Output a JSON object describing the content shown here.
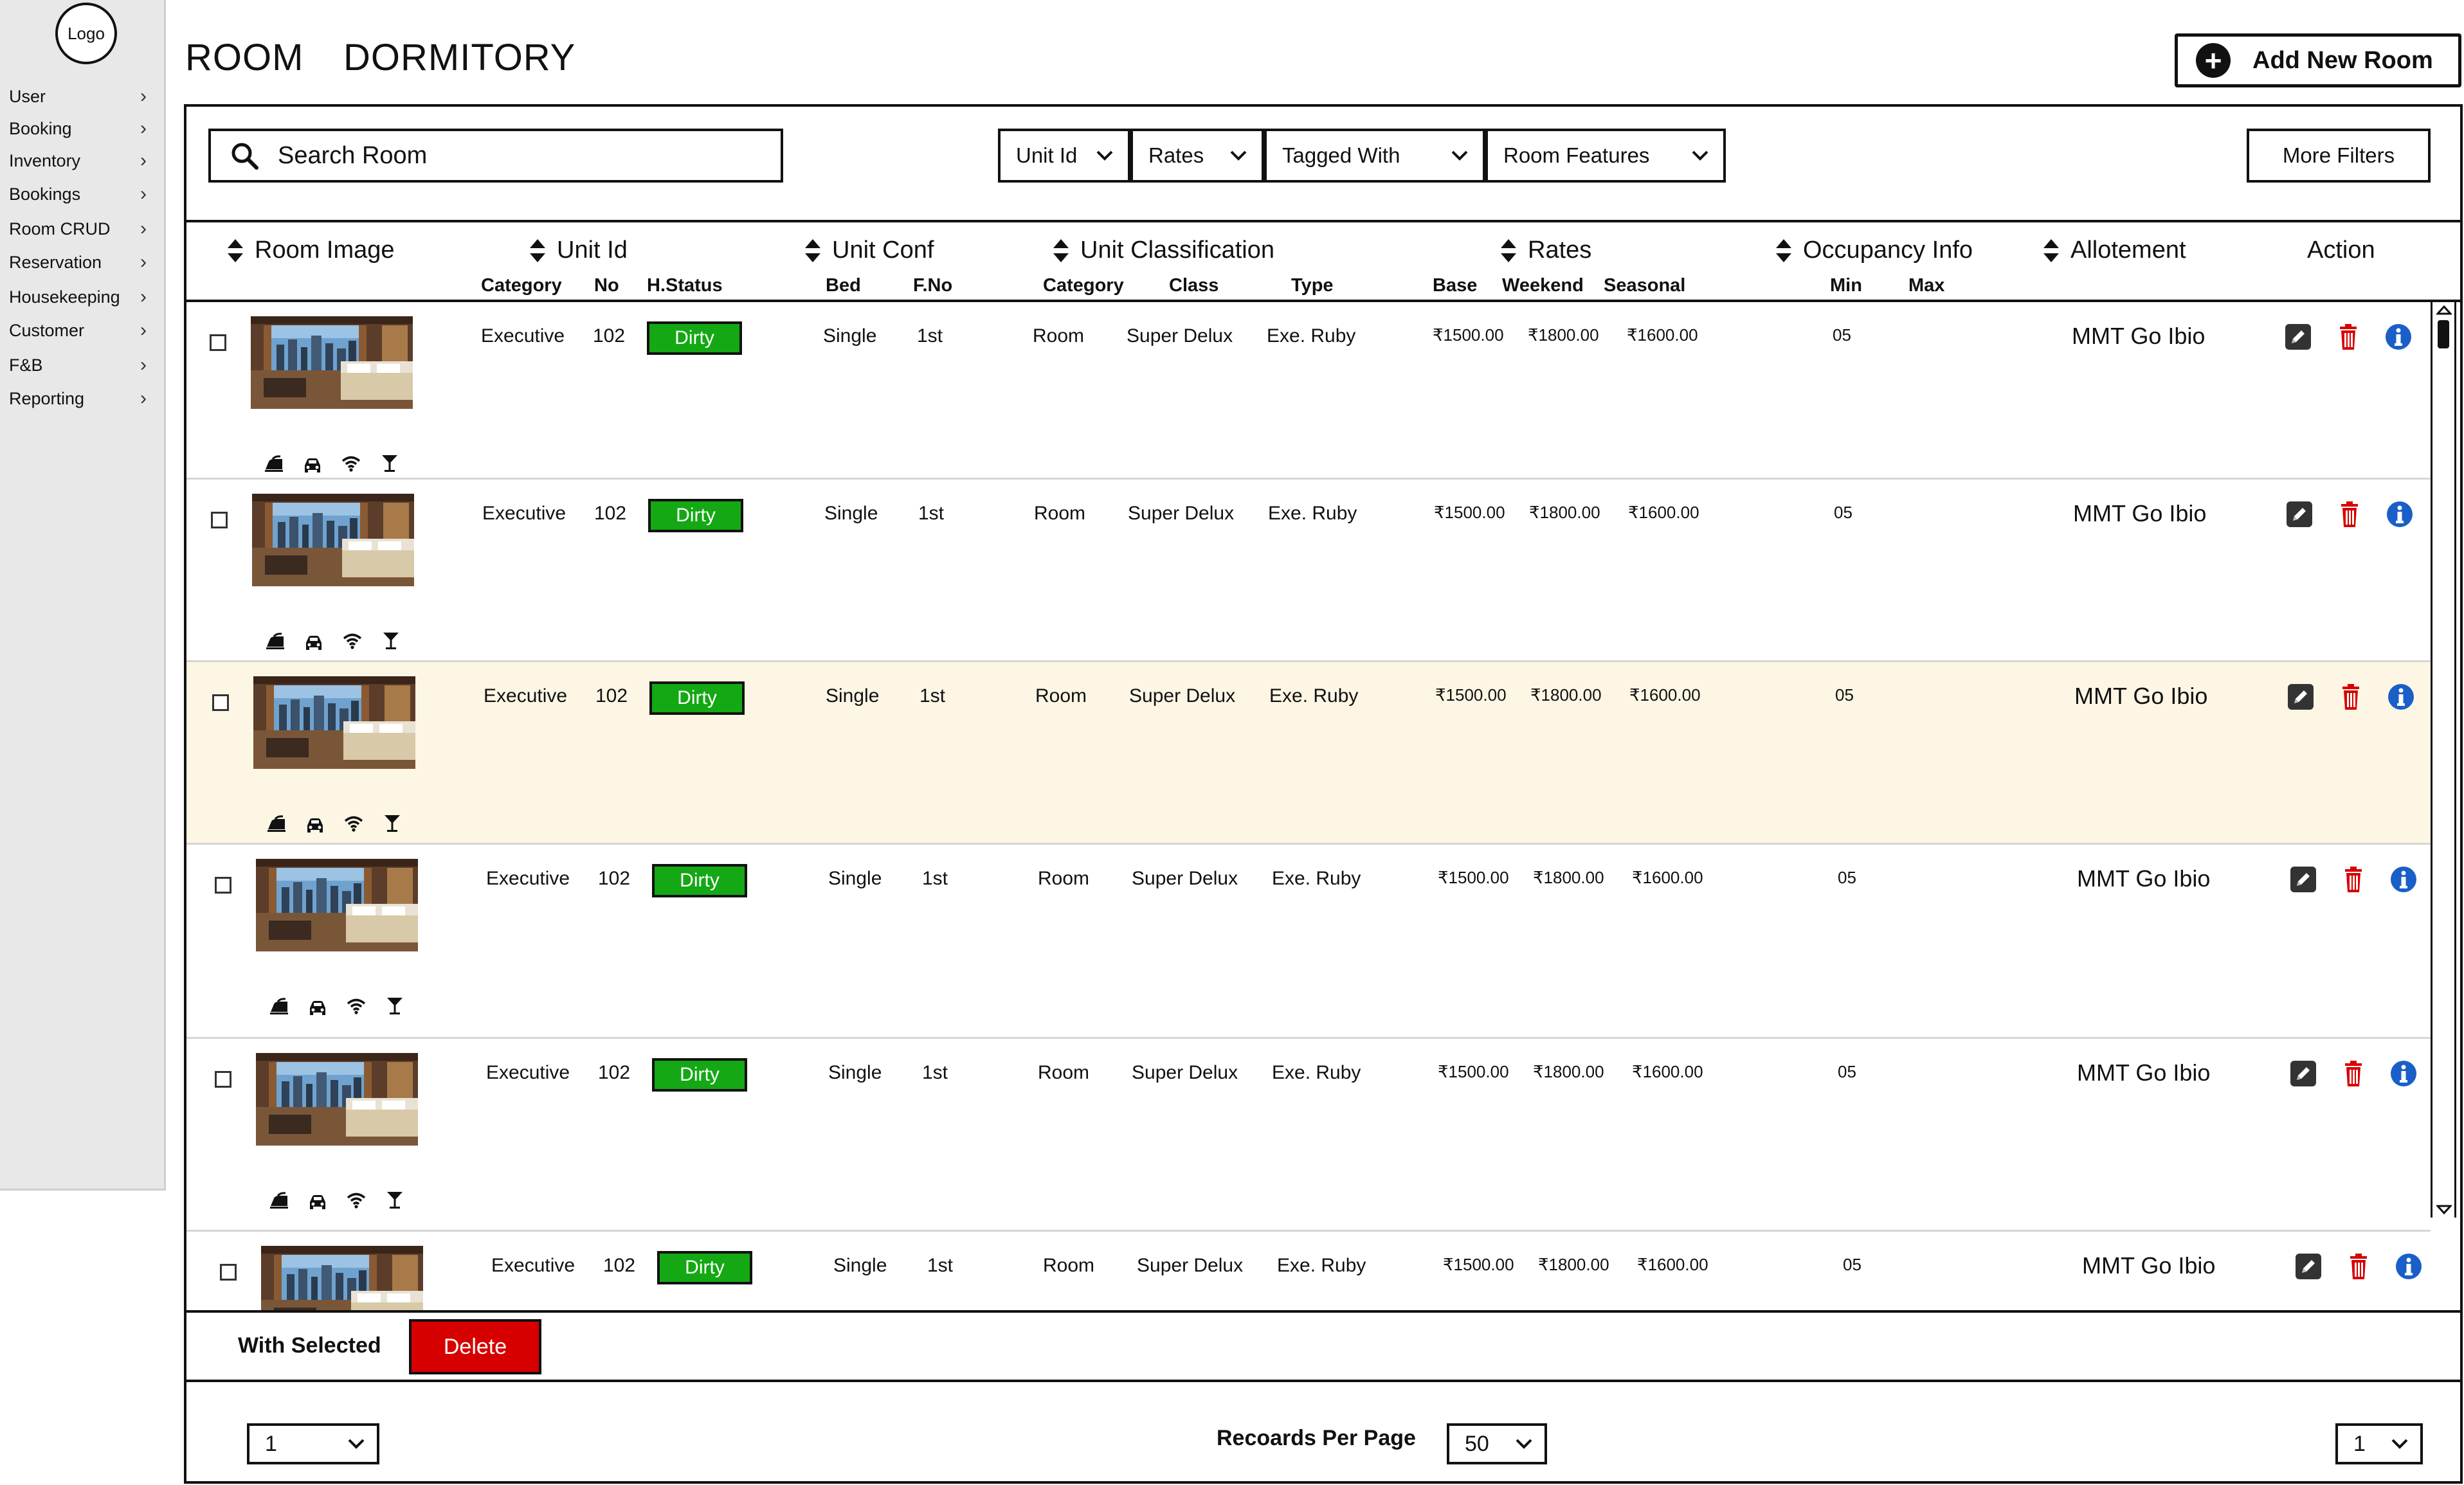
{
  "sidebar": {
    "logo": "Logo",
    "items": [
      {
        "label": "User"
      },
      {
        "label": "Booking"
      },
      {
        "label": "Inventory"
      },
      {
        "label": "Bookings"
      },
      {
        "label": "Room CRUD"
      },
      {
        "label": "Reservation"
      },
      {
        "label": "Housekeeping"
      },
      {
        "label": "Customer"
      },
      {
        "label": "F&B"
      },
      {
        "label": "Reporting"
      }
    ]
  },
  "tabs": [
    {
      "label": "ROOM"
    },
    {
      "label": "DORMITORY"
    }
  ],
  "add_button_label": "Add New Room",
  "search": {
    "placeholder": "Search Room"
  },
  "filters": [
    {
      "label": "Unit Id"
    },
    {
      "label": "Rates"
    },
    {
      "label": "Tagged With"
    },
    {
      "label": "Room Features"
    }
  ],
  "more_filters_label": "More Filters",
  "columns": {
    "room_image": "Room Image",
    "unit_id": {
      "title": "Unit Id",
      "category": "Category",
      "no": "No",
      "hstatus": "H.Status"
    },
    "unit_conf": {
      "title": "Unit Conf",
      "bed": "Bed",
      "fno": "F.No"
    },
    "unit_class": {
      "title": "Unit Classification",
      "category": "Category",
      "class": "Class",
      "type": "Type"
    },
    "rates": {
      "title": "Rates",
      "base": "Base",
      "weekend": "Weekend",
      "seasonal": "Seasonal"
    },
    "occupancy": {
      "title": "Occupancy Info",
      "min": "Min",
      "max": "Max"
    },
    "allotment": "Allotement",
    "action": "Action"
  },
  "rows": [
    {
      "category": "Executive",
      "no": "102",
      "hstatus": "Dirty",
      "bed": "Single",
      "fno": "1st",
      "uc_category": "Room",
      "uc_class": "Super Delux",
      "uc_type": "Exe. Ruby",
      "base": "₹1500.00",
      "weekend": "₹1800.00",
      "seasonal": "₹1600.00",
      "min": "05",
      "allotment": "MMT  Go Ibio",
      "highlighted": false
    },
    {
      "category": "Executive",
      "no": "102",
      "hstatus": "Dirty",
      "bed": "Single",
      "fno": "1st",
      "uc_category": "Room",
      "uc_class": "Super Delux",
      "uc_type": "Exe. Ruby",
      "base": "₹1500.00",
      "weekend": "₹1800.00",
      "seasonal": "₹1600.00",
      "min": "05",
      "allotment": "MMT  Go Ibio",
      "highlighted": false
    },
    {
      "category": "Executive",
      "no": "102",
      "hstatus": "Dirty",
      "bed": "Single",
      "fno": "1st",
      "uc_category": "Room",
      "uc_class": "Super Delux",
      "uc_type": "Exe. Ruby",
      "base": "₹1500.00",
      "weekend": "₹1800.00",
      "seasonal": "₹1600.00",
      "min": "05",
      "allotment": "MMT  Go Ibio",
      "highlighted": true
    },
    {
      "category": "Executive",
      "no": "102",
      "hstatus": "Dirty",
      "bed": "Single",
      "fno": "1st",
      "uc_category": "Room",
      "uc_class": "Super Delux",
      "uc_type": "Exe. Ruby",
      "base": "₹1500.00",
      "weekend": "₹1800.00",
      "seasonal": "₹1600.00",
      "min": "05",
      "allotment": "MMT  Go Ibio",
      "highlighted": false
    },
    {
      "category": "Executive",
      "no": "102",
      "hstatus": "Dirty",
      "bed": "Single",
      "fno": "1st",
      "uc_category": "Room",
      "uc_class": "Super Delux",
      "uc_type": "Exe. Ruby",
      "base": "₹1500.00",
      "weekend": "₹1800.00",
      "seasonal": "₹1600.00",
      "min": "05",
      "allotment": "MMT  Go Ibio",
      "highlighted": false
    },
    {
      "category": "Executive",
      "no": "102",
      "hstatus": "Dirty",
      "bed": "Single",
      "fno": "1st",
      "uc_category": "Room",
      "uc_class": "Super Delux",
      "uc_type": "Exe. Ruby",
      "base": "₹1500.00",
      "weekend": "₹1800.00",
      "seasonal": "₹1600.00",
      "min": "05",
      "allotment": "MMT  Go Ibio",
      "highlighted": false
    }
  ],
  "amenity_icons": [
    "iron-icon",
    "car-icon",
    "wifi-icon",
    "cocktail-icon"
  ],
  "row_action_icons": [
    "edit-icon",
    "trash-icon",
    "info-icon"
  ],
  "footer": {
    "with_selected": "With Selected",
    "delete_label": "Delete",
    "page_select_left": "1",
    "records_per_page_label": "Recoards Per Page",
    "records_per_page_value": "50",
    "page_select_right": "1"
  },
  "colors": {
    "status_dirty": "#14a814",
    "delete": "#d60000",
    "edit": "#333333",
    "trash": "#d60000",
    "info": "#1a5fc8",
    "highlight_row": "#fdf6e4"
  }
}
